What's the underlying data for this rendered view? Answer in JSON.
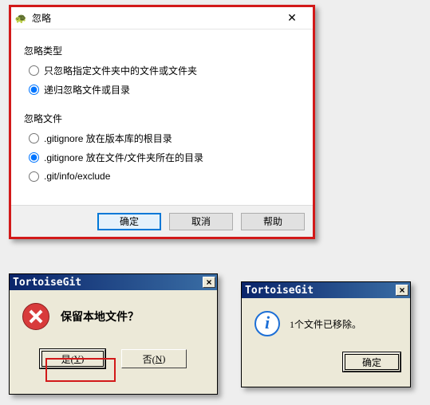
{
  "dialog1": {
    "title": "忽略",
    "group1": {
      "label": "忽略类型",
      "options": [
        {
          "label": "只忽略指定文件夹中的文件或文件夹",
          "selected": false
        },
        {
          "label": "递归忽略文件或目录",
          "selected": true
        }
      ]
    },
    "group2": {
      "label": "忽略文件",
      "options": [
        {
          "label": ".gitignore 放在版本库的根目录",
          "selected": false
        },
        {
          "label": ".gitignore 放在文件/文件夹所在的目录",
          "selected": true
        },
        {
          "label": ".git/info/exclude",
          "selected": false
        }
      ]
    },
    "buttons": {
      "ok": "确定",
      "cancel": "取消",
      "help": "帮助"
    }
  },
  "dialog2": {
    "title": "TortoiseGit",
    "message": "保留本地文件？",
    "yes": {
      "prefix": "是(",
      "mnemonic": "Y",
      "suffix": ")"
    },
    "no": {
      "prefix": "否(",
      "mnemonic": "N",
      "suffix": ")"
    }
  },
  "dialog3": {
    "title": "TortoiseGit",
    "message": "1个文件已移除。",
    "ok": "确定"
  }
}
